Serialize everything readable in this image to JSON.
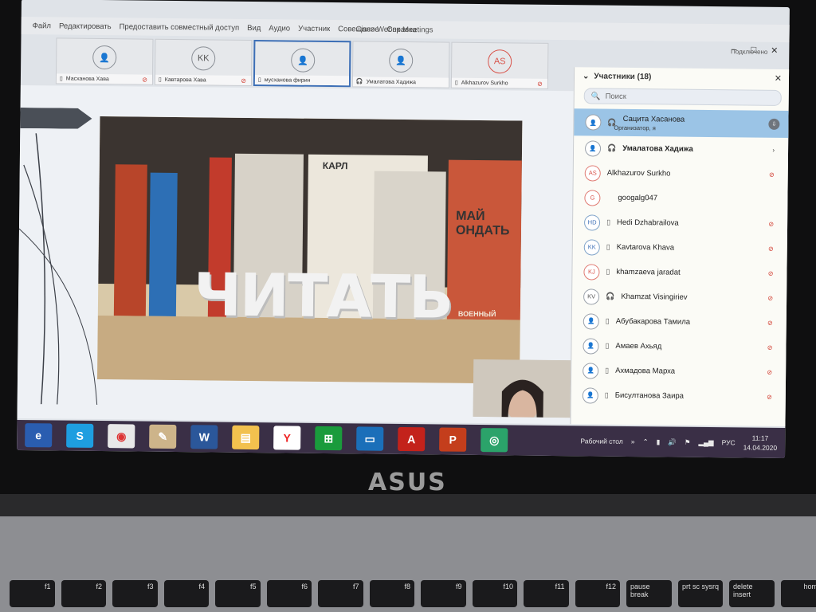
{
  "window": {
    "title": "Cisco Webex Meetings",
    "menu": [
      "Файл",
      "Редактировать",
      "Предоставить совместный доступ",
      "Вид",
      "Аудио",
      "Участник",
      "Совещание",
      "Справка"
    ],
    "connection_status": "Подключено"
  },
  "thumbnails": [
    {
      "initials": "",
      "name": "Масханова Хава"
    },
    {
      "initials": "KK",
      "name": "Кавтарова Хава"
    },
    {
      "initials": "",
      "name": "мусханова фирин"
    },
    {
      "initials": "",
      "name": "Умалатова Хадижа"
    },
    {
      "initials": "AS",
      "name": "Alkhazurov Surkho"
    }
  ],
  "shared_content": {
    "word": "ЧИТАТЬ",
    "books": [
      "КАРЛ",
      "МАЙ",
      "ОНДАТЬ",
      "ВОЕННЫЙ"
    ]
  },
  "participants": {
    "header": "Участники (18)",
    "search_placeholder": "Поиск",
    "list": [
      {
        "initials": "",
        "name": "Сацита Хасанова",
        "sub": "Организатор, я",
        "selected": true
      },
      {
        "initials": "",
        "name": "Умалатова Хадижа",
        "sub": ""
      },
      {
        "initials": "AS",
        "name": "Alkhazurov Surkho",
        "sub": ""
      },
      {
        "initials": "G",
        "name": "googalg047",
        "sub": ""
      },
      {
        "initials": "HD",
        "name": "Hedi Dzhabrailova",
        "sub": ""
      },
      {
        "initials": "KK",
        "name": "Kavtarova Khava",
        "sub": ""
      },
      {
        "initials": "KJ",
        "name": "khamzaeva jaradat",
        "sub": ""
      },
      {
        "initials": "KV",
        "name": "Khamzat Visingiriev",
        "sub": ""
      },
      {
        "initials": "",
        "name": "Абубакарова Тамила",
        "sub": ""
      },
      {
        "initials": "",
        "name": "Амаев Ахьяд",
        "sub": ""
      },
      {
        "initials": "",
        "name": "Ахмадова Марха",
        "sub": ""
      },
      {
        "initials": "",
        "name": "Бисултанова Заира",
        "sub": ""
      }
    ]
  },
  "taskbar": {
    "apps": [
      "edge-icon",
      "skype-icon",
      "chrome-icon",
      "paint-icon",
      "word-icon",
      "explorer-icon",
      "yandex-icon",
      "store-icon",
      "photos-icon",
      "acrobat-icon",
      "powerpoint-icon",
      "webex-icon"
    ],
    "desktop_label": "Рабочий стол",
    "language": "РУС",
    "time": "11:17",
    "date": "14.04.2020"
  },
  "laptop": {
    "brand": "ASUS",
    "keys": [
      "f1",
      "f2",
      "f3",
      "f4",
      "f5",
      "f6",
      "f7",
      "f8",
      "f9",
      "f10",
      "f11",
      "f12",
      "pause break",
      "prt sc sysrq",
      "delete insert",
      "home"
    ]
  }
}
